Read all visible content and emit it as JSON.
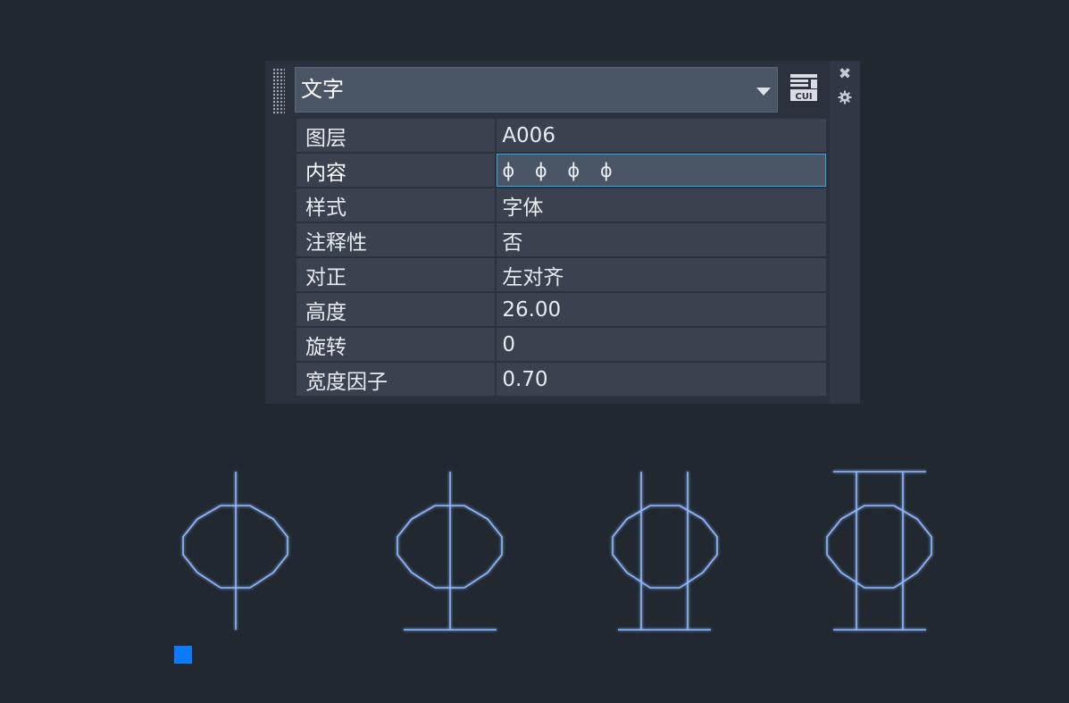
{
  "palette": {
    "object_type": "文字",
    "cui_label": "CUI",
    "close_glyph": "✖",
    "properties": [
      {
        "label": "图层",
        "value": "A006"
      },
      {
        "label": "内容",
        "value": "ɸ ɸ ɸ ɸ"
      },
      {
        "label": "样式",
        "value": "字体"
      },
      {
        "label": "注释性",
        "value": "否"
      },
      {
        "label": "对正",
        "value": "左对齐"
      },
      {
        "label": "高度",
        "value": "26.00"
      },
      {
        "label": "旋转",
        "value": "0"
      },
      {
        "label": "宽度因子",
        "value": "0.70"
      }
    ]
  },
  "colors": {
    "background": "#212830",
    "panel": "#2b323d",
    "cell": "#3a4250",
    "highlight": "#3aa0e8",
    "cad_lines": "#8fb8ff",
    "grip": "#0a7bff"
  },
  "canvas": {
    "glyph_count": 4
  }
}
